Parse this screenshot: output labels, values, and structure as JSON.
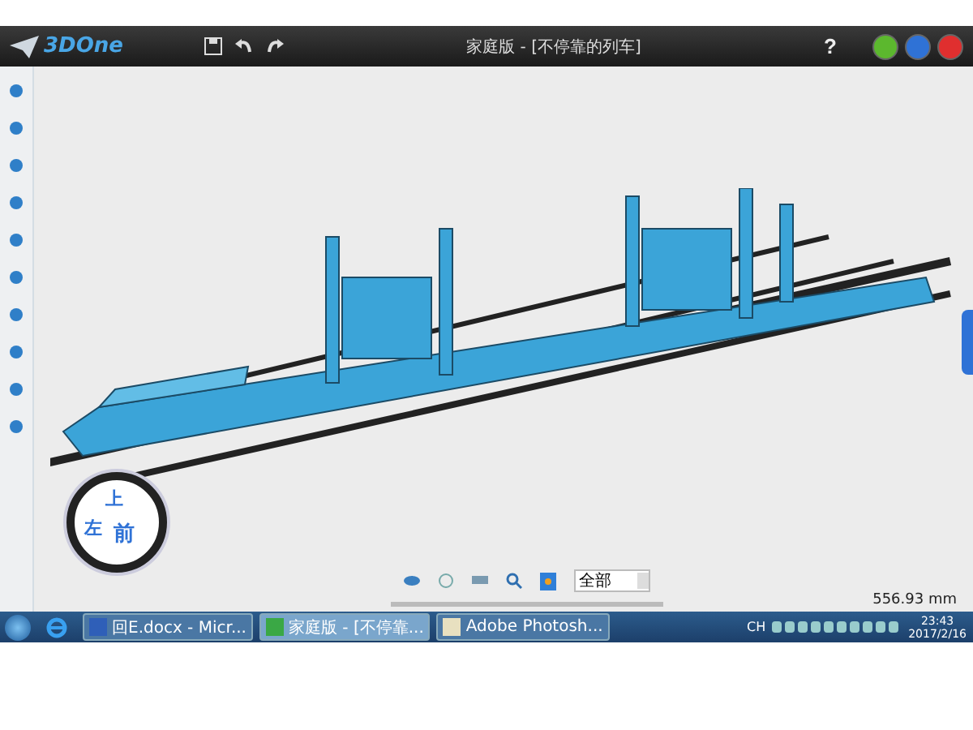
{
  "title_bar": {
    "logo": "3DOne",
    "title": "家庭版 - [不停靠的列车]",
    "help": "?"
  },
  "view_cube": {
    "top": "上",
    "left": "左",
    "front": "前"
  },
  "view_toolbar": {
    "filter": "全部"
  },
  "status": {
    "measure": "556.93 mm"
  },
  "taskbar": {
    "items": [
      {
        "kind": "word",
        "label": "回E.docx - Micr...",
        "selected": false
      },
      {
        "kind": "app",
        "label": "家庭版 - [不停靠...",
        "selected": true
      },
      {
        "kind": "photoshop",
        "label": "Adobe Photosh...",
        "selected": false
      }
    ],
    "ime": "CH",
    "time": "23:43",
    "date": "2017/2/16"
  }
}
